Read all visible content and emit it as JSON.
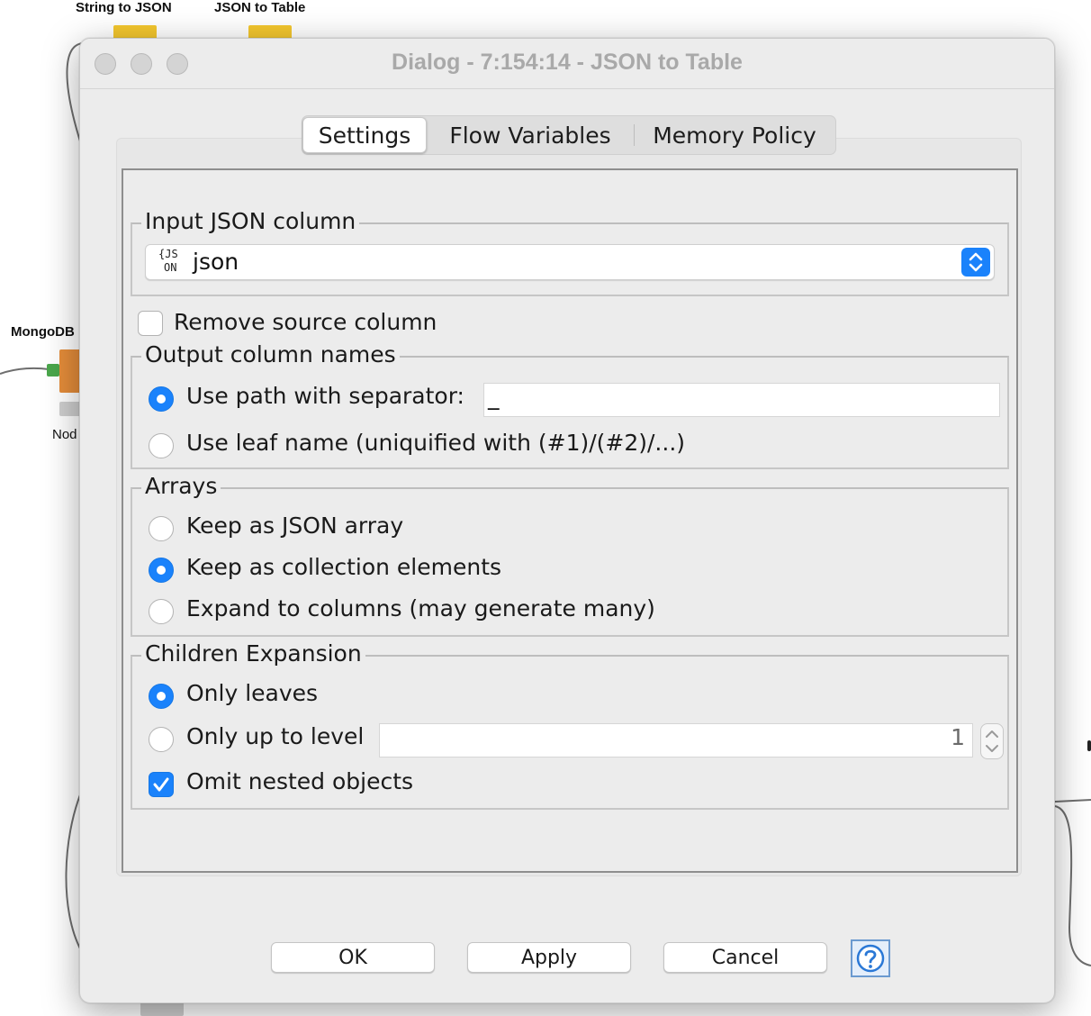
{
  "canvas": {
    "node_labels": {
      "string_to_json": "String to JSON",
      "json_to_table": "JSON to Table",
      "mongodb": "MongoDB",
      "node": "Nod"
    },
    "colors": {
      "node_yellow": "#f4c72e",
      "node_orange": "#e58d3a",
      "port_green": "#4aa64b"
    }
  },
  "window": {
    "title": "Dialog - 7:154:14 - JSON to Table",
    "tabs": [
      {
        "label": "Settings",
        "active": true
      },
      {
        "label": "Flow Variables",
        "active": false
      },
      {
        "label": "Memory Policy",
        "active": false
      }
    ]
  },
  "settings": {
    "input_json_column": {
      "title": "Input JSON column",
      "icon": "json-column-icon",
      "icon_text_top": "{JS",
      "icon_text_bottom": "ON",
      "selected": "json"
    },
    "remove_source_column": {
      "label": "Remove source column",
      "checked": false
    },
    "output_column_names": {
      "title": "Output column names",
      "use_path_label": "Use path with separator:",
      "use_path_selected": true,
      "separator_value": "_",
      "use_leaf_label": "Use leaf name (uniquified with (#1)/(#2)/...)",
      "use_leaf_selected": false
    },
    "arrays": {
      "title": "Arrays",
      "options": [
        {
          "label": "Keep as JSON array",
          "selected": false
        },
        {
          "label": "Keep as collection elements",
          "selected": true
        },
        {
          "label": "Expand to columns (may generate many)",
          "selected": false
        }
      ]
    },
    "children_expansion": {
      "title": "Children Expansion",
      "only_leaves_label": "Only leaves",
      "only_leaves_selected": true,
      "only_up_to_level_label": "Only up to level",
      "only_up_to_level_selected": false,
      "level_value": "1",
      "omit_nested_label": "Omit nested objects",
      "omit_nested_checked": true
    }
  },
  "footer": {
    "ok_label": "OK",
    "apply_label": "Apply",
    "cancel_label": "Cancel",
    "help_icon": "help-question-icon"
  },
  "accent_color": "#1a82fb"
}
